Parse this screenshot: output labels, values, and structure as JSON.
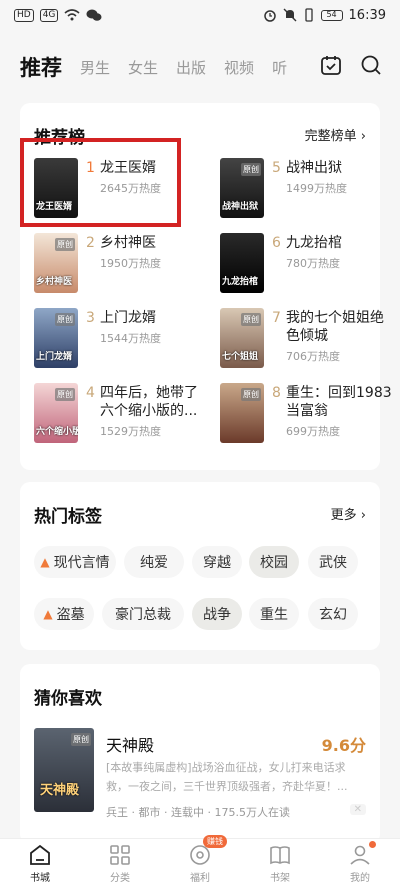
{
  "status_bar": {
    "left_chips": [
      "HD",
      "4G"
    ],
    "time": "16:39",
    "battery": "54"
  },
  "header": {
    "active_tab": "推荐",
    "tabs": [
      "男生",
      "女生",
      "出版",
      "视频",
      "听"
    ]
  },
  "ranking": {
    "title": "推荐榜",
    "more": "完整榜单 ›",
    "items": [
      {
        "rank": "1",
        "name": "龙王医婿",
        "heat": "2645万热度",
        "cover_text": "龙王医婿",
        "cover_tag": "",
        "colors": [
          "#3a3a3a",
          "#111"
        ]
      },
      {
        "rank": "2",
        "name": "乡村神医",
        "heat": "1950万热度",
        "cover_text": "乡村神医",
        "cover_tag": "原创",
        "colors": [
          "#f3e6d8",
          "#c78a6a"
        ]
      },
      {
        "rank": "3",
        "name": "上门龙婿",
        "heat": "1544万热度",
        "cover_text": "上门龙婿",
        "cover_tag": "原创",
        "colors": [
          "#8fa7c7",
          "#2e3f66"
        ]
      },
      {
        "rank": "4",
        "name": "四年后，她带了六个缩小版的...",
        "heat": "1529万热度",
        "cover_text": "六个缩小版",
        "cover_tag": "原创",
        "colors": [
          "#f4d6d6",
          "#c0647a"
        ]
      },
      {
        "rank": "5",
        "name": "战神出狱",
        "heat": "1499万热度",
        "cover_text": "战神出狱",
        "cover_tag": "原创",
        "colors": [
          "#444",
          "#111"
        ]
      },
      {
        "rank": "6",
        "name": "九龙抬棺",
        "heat": "780万热度",
        "cover_text": "九龙抬棺",
        "cover_tag": "",
        "colors": [
          "#2a2a2a",
          "#000"
        ]
      },
      {
        "rank": "7",
        "name": "我的七个姐姐绝色倾城",
        "heat": "706万热度",
        "cover_text": "七个姐姐",
        "cover_tag": "原创",
        "colors": [
          "#d9c8b4",
          "#7a5a4a"
        ]
      },
      {
        "rank": "8",
        "name": "重生：回到1983当富翁",
        "heat": "699万热度",
        "cover_text": "",
        "cover_tag": "原创",
        "colors": [
          "#c9a88a",
          "#6b3a2a"
        ]
      }
    ]
  },
  "tags": {
    "title": "热门标签",
    "more": "更多 ›",
    "row1": [
      {
        "label": "现代言情",
        "fire": true,
        "selected": false
      },
      {
        "label": "纯爱",
        "fire": false,
        "selected": false
      },
      {
        "label": "穿越",
        "fire": false,
        "selected": false
      },
      {
        "label": "校园",
        "fire": false,
        "selected": true
      },
      {
        "label": "武侠",
        "fire": false,
        "selected": false
      }
    ],
    "row2": [
      {
        "label": "盗墓",
        "fire": true,
        "selected": false
      },
      {
        "label": "豪门总裁",
        "fire": false,
        "selected": false
      },
      {
        "label": "战争",
        "fire": false,
        "selected": true
      },
      {
        "label": "重生",
        "fire": false,
        "selected": false
      },
      {
        "label": "玄幻",
        "fire": false,
        "selected": false
      }
    ]
  },
  "guess": {
    "title": "猜你喜欢",
    "book": {
      "title": "天神殿",
      "score": "9.6分",
      "cover_tag": "原创",
      "cover_text": "天神殿",
      "desc": "[本故事纯属虚构]战场浴血征战，女儿打来电话求救，一夜之间，三千世界顶级强者，齐赴华夏！...",
      "meta": "兵王 · 都市 · 连载中 · 175.5万人在读",
      "close": "✕"
    }
  },
  "bottom_nav": {
    "items": [
      {
        "label": "书城",
        "icon": "home-icon",
        "active": true
      },
      {
        "label": "分类",
        "icon": "grid-icon",
        "active": false
      },
      {
        "label": "福利",
        "icon": "coin-icon",
        "active": false,
        "badge": "赚钱"
      },
      {
        "label": "书架",
        "icon": "book-icon",
        "active": false
      },
      {
        "label": "我的",
        "icon": "user-icon",
        "active": false,
        "dot": true
      }
    ]
  },
  "colors": {
    "rank_top": "#f07a3a",
    "rank_normal": "#c9a87a",
    "highlight": "#d32323",
    "accent": "#d48a3a"
  }
}
